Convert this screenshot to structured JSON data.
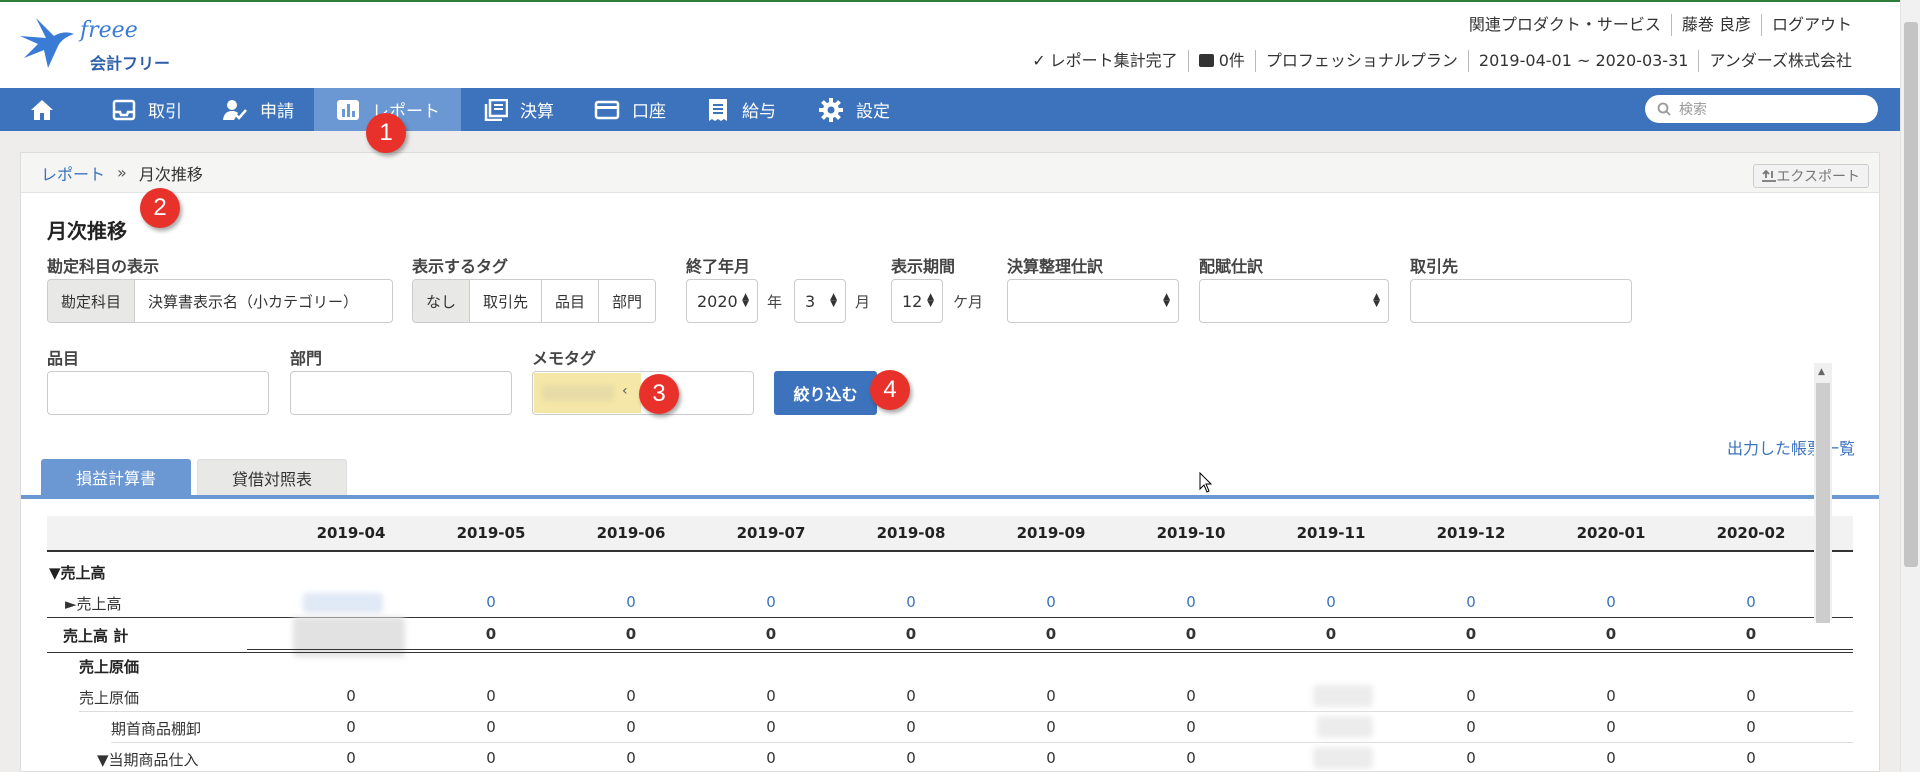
{
  "header": {
    "brand_text": "freee",
    "product_name": "会計フリー",
    "top_links": [
      "関連プロダクト・サービス",
      "藤巻 良彦",
      "ログアウト"
    ],
    "status": {
      "report_done_check": "✓",
      "report_done": "レポート集計完了",
      "messages": "0件",
      "plan": "プロフェッショナルプラン",
      "period": "2019-04-01 ~ 2020-03-31",
      "company": "アンダーズ株式会社"
    }
  },
  "nav": {
    "items": [
      {
        "label": "取引",
        "icon": "inbox-icon"
      },
      {
        "label": "申請",
        "icon": "user-check-icon"
      },
      {
        "label": "レポート",
        "icon": "bar-chart-icon"
      },
      {
        "label": "決算",
        "icon": "ledger-icon"
      },
      {
        "label": "口座",
        "icon": "credit-card-icon"
      },
      {
        "label": "給与",
        "icon": "receipt-icon"
      },
      {
        "label": "設定",
        "icon": "gear-icon"
      }
    ],
    "search_placeholder": "検索"
  },
  "breadcrumb": {
    "parent": "レポート",
    "separator": "»",
    "current": "月次推移"
  },
  "export_label": "エクスポート",
  "page_title": "月次推移",
  "filters": {
    "account_display_label": "勘定科目の表示",
    "account_display_options": [
      "勘定科目",
      "決算書表示名（小カテゴリー）"
    ],
    "tags_label": "表示するタグ",
    "tags_options": [
      "なし",
      "取引先",
      "品目",
      "部門"
    ],
    "end_month_label": "終了年月",
    "end_year": "2020",
    "year_unit": "年",
    "end_month": "3",
    "month_unit": "月",
    "period_label": "表示期間",
    "period_value": "12",
    "period_unit": "ケ月",
    "closing_label": "決算整理仕訳",
    "allocation_label": "配賦仕訳",
    "partner_label": "取引先",
    "item_label": "品目",
    "department_label": "部門",
    "memo_tag_label": "メモタグ",
    "memo_tag_remove": "‹",
    "filter_button": "絞り込む"
  },
  "report_list_link": "出力した帳票一覧",
  "tabs": [
    "損益計算書",
    "貸借対照表"
  ],
  "table": {
    "months": [
      "2019-04",
      "2019-05",
      "2019-06",
      "2019-07",
      "2019-08",
      "2019-09",
      "2019-10",
      "2019-11",
      "2019-12",
      "2020-01",
      "2020-02"
    ],
    "rows": [
      {
        "label": "▼売上高",
        "bold": true,
        "values": []
      },
      {
        "label": "►売上高",
        "bold": false,
        "values": [
          "",
          "0",
          "0",
          "0",
          "0",
          "0",
          "0",
          "0",
          "0",
          "0",
          "0"
        ],
        "link": true
      },
      {
        "label": "売上高 計",
        "bold": true,
        "values": [
          "",
          "0",
          "0",
          "0",
          "0",
          "0",
          "0",
          "0",
          "0",
          "0",
          "0"
        ]
      },
      {
        "label": "売上原価",
        "bold": true,
        "values": []
      },
      {
        "label": "売上原価",
        "bold": false,
        "values": [
          "0",
          "0",
          "0",
          "0",
          "0",
          "0",
          "0",
          "",
          "0",
          "0",
          "0"
        ]
      },
      {
        "label": "期首商品棚卸",
        "bold": false,
        "values": [
          "0",
          "0",
          "0",
          "0",
          "0",
          "0",
          "0",
          "",
          "0",
          "0",
          "0"
        ]
      },
      {
        "label": "▼当期商品仕入",
        "bold": false,
        "values": [
          "0",
          "0",
          "0",
          "0",
          "0",
          "0",
          "0",
          "",
          "0",
          "0",
          "0"
        ]
      }
    ]
  },
  "markers": [
    "1",
    "2",
    "3",
    "4"
  ],
  "colors": {
    "nav_bg": "#3d73bd",
    "nav_active": "#6b98d2",
    "marker": "#e8312a",
    "link": "#3d73bd"
  }
}
